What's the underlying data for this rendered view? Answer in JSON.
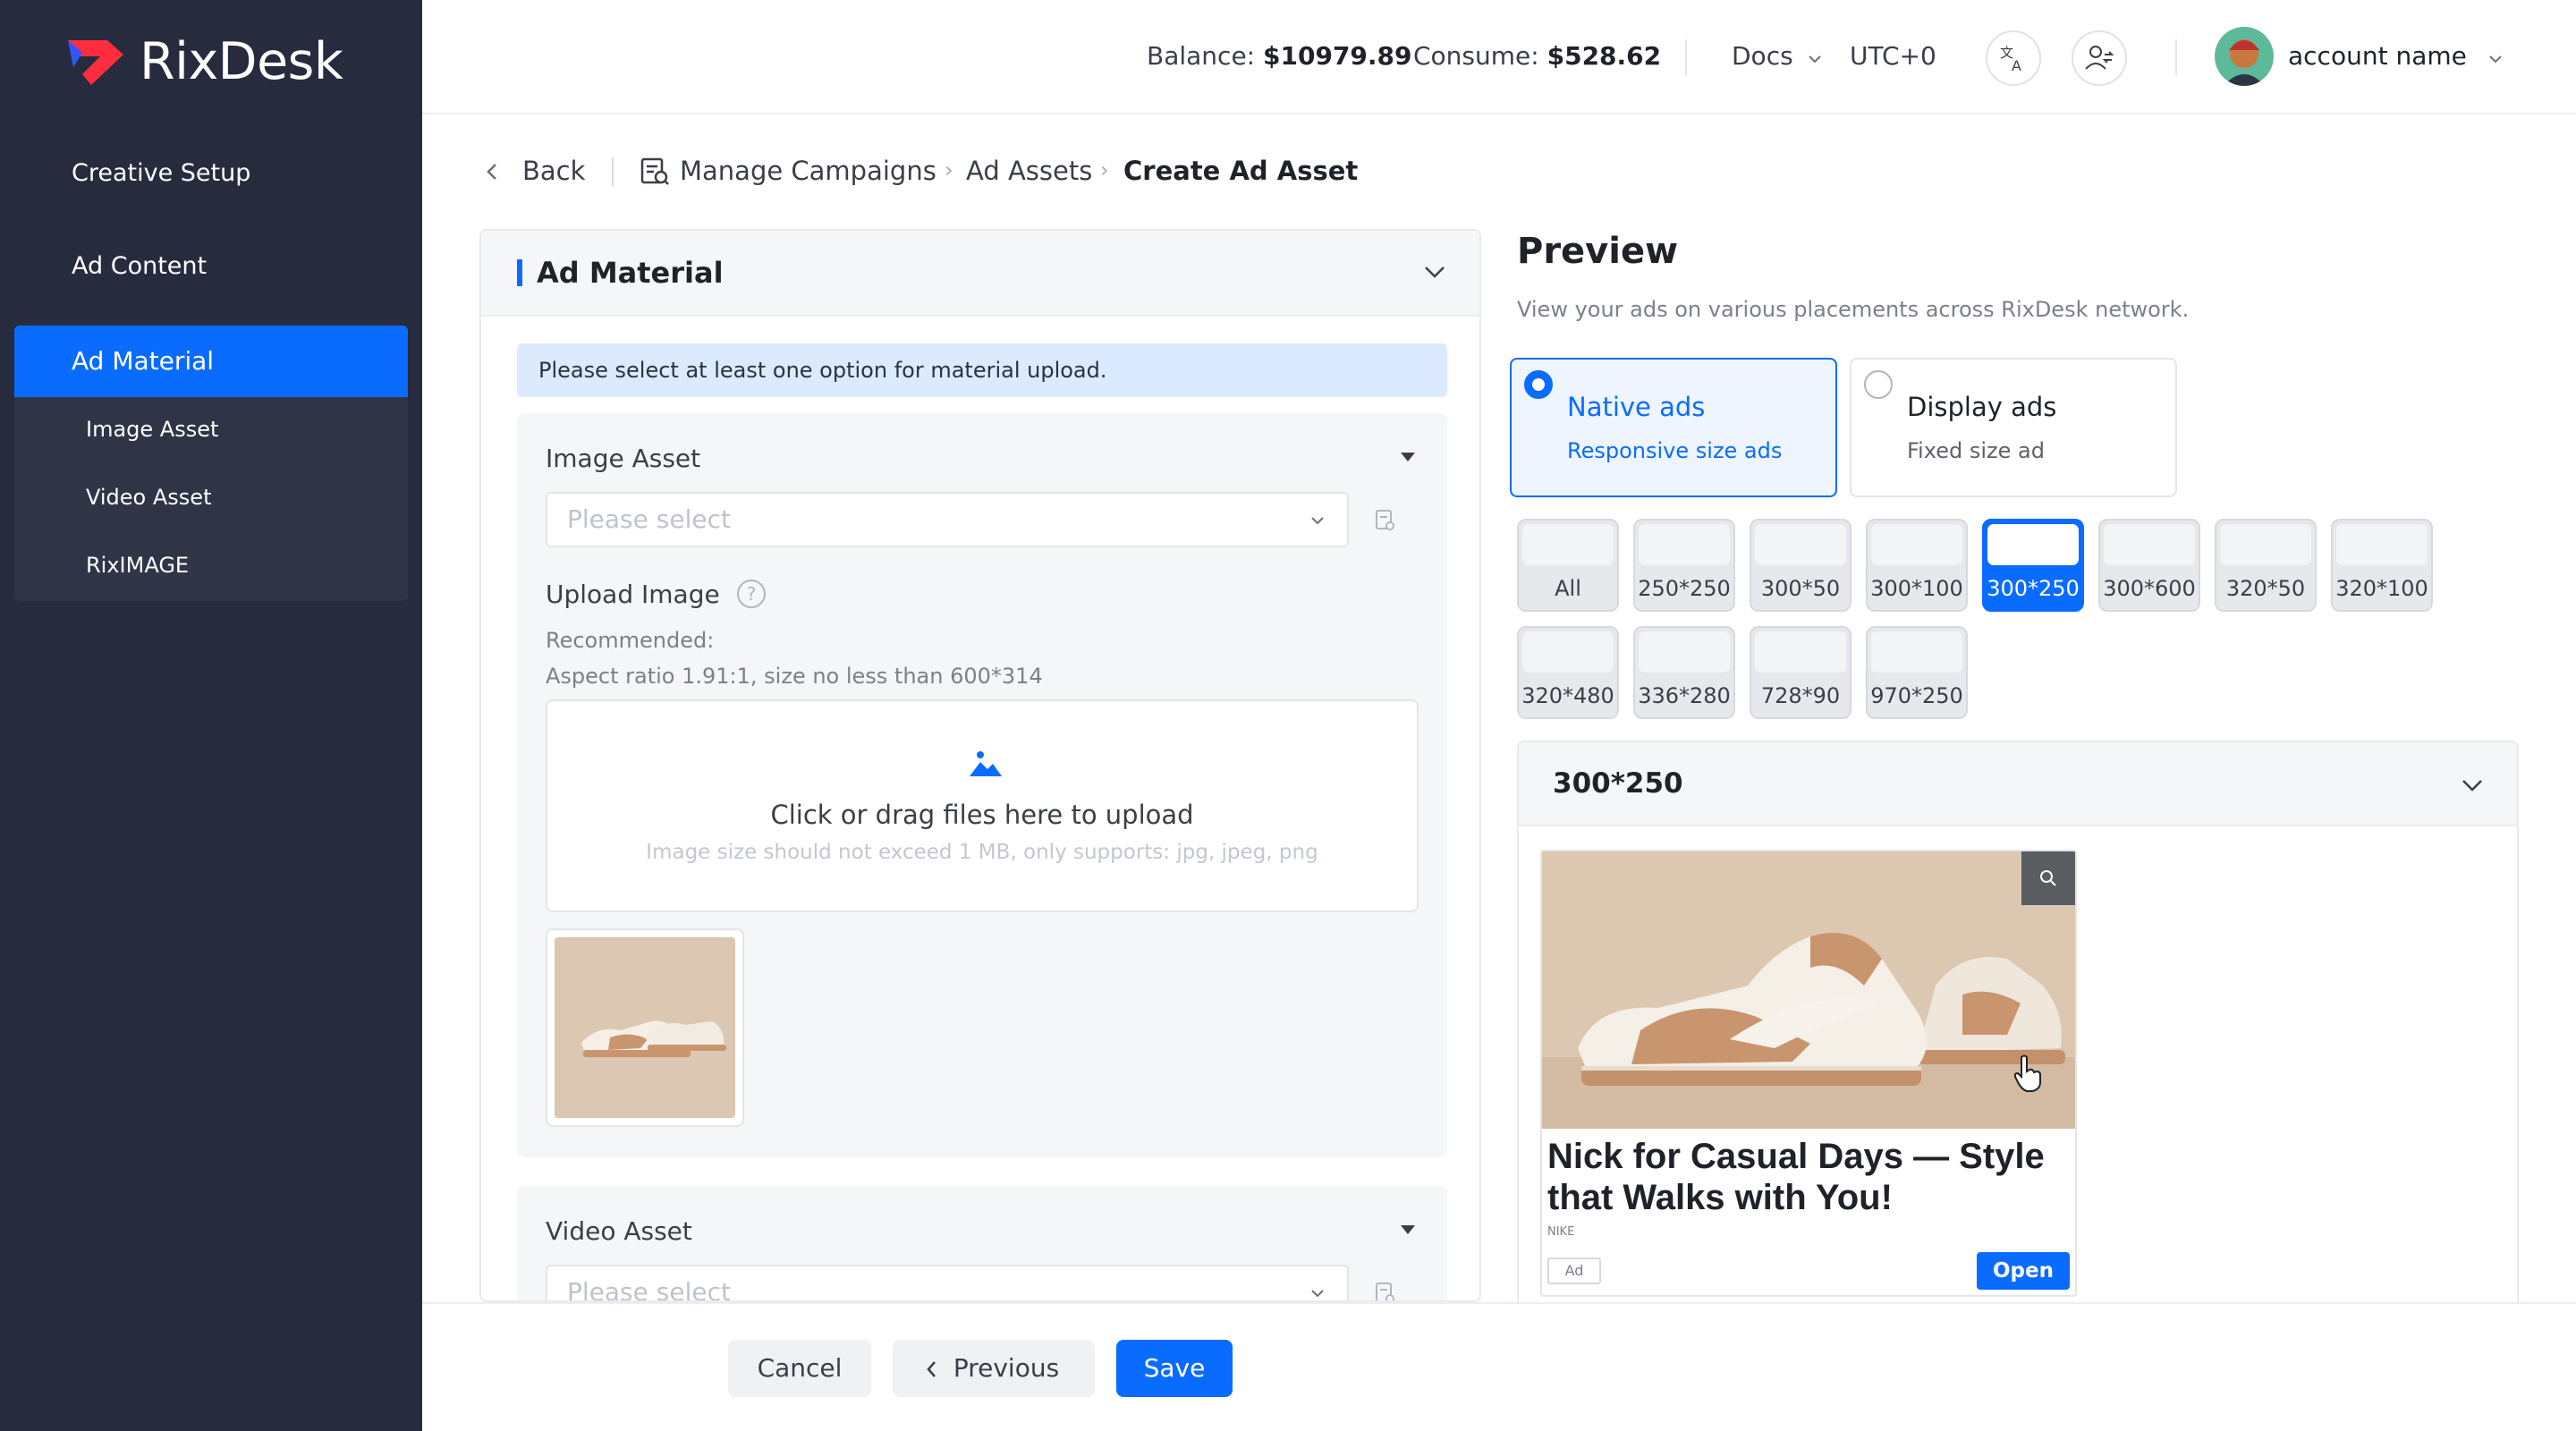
{
  "app": {
    "name": "RixDesk"
  },
  "sidebar": {
    "items": [
      {
        "label": "Creative Setup"
      },
      {
        "label": "Ad Content"
      },
      {
        "label": "Ad Material"
      }
    ],
    "subitems": [
      {
        "label": "Image Asset"
      },
      {
        "label": "Video Asset"
      },
      {
        "label": "RixIMAGE"
      }
    ]
  },
  "header": {
    "balance_label": "Balance:",
    "balance_value": "$10979.89",
    "consume_label": "Consume:",
    "consume_value": "$528.62",
    "docs": "Docs",
    "timezone": "UTC+0",
    "account_name": "account name"
  },
  "breadcrumb": {
    "back": "Back",
    "items": [
      "Manage Campaigns",
      "Ad Assets",
      "Create Ad Asset"
    ]
  },
  "material": {
    "title": "Ad Material",
    "notice": "Please select at least one option for material upload.",
    "image_asset": {
      "title": "Image Asset",
      "placeholder": "Please select",
      "upload_label": "Upload Image",
      "recommended": "Recommended:",
      "aspect": "Aspect ratio 1.91:1, size no less than 600*314",
      "upload_main": "Click or drag files here to upload",
      "upload_hint": "Image size should not exceed 1 MB, only supports: jpg, jpeg, png"
    },
    "video_asset": {
      "title": "Video Asset",
      "placeholder": "Please select"
    }
  },
  "preview": {
    "title": "Preview",
    "subtitle": "View your ads on various placements across RixDesk network.",
    "options": [
      {
        "title": "Native ads",
        "sub": "Responsive size ads",
        "selected": true
      },
      {
        "title": "Display ads",
        "sub": "Fixed size ad",
        "selected": false
      }
    ],
    "sizes": [
      "All",
      "250*250",
      "300*50",
      "300*100",
      "300*250",
      "300*600",
      "320*50",
      "320*100",
      "320*480",
      "336*280",
      "728*90",
      "970*250"
    ],
    "selected_size": "300*250",
    "panel_title": "300*250",
    "ad": {
      "headline": "Nick for Casual Days — Style that Walks with You!",
      "brand": "NIKE",
      "ad_badge": "Ad",
      "cta": "Open"
    }
  },
  "footer": {
    "cancel": "Cancel",
    "previous": "Previous",
    "save": "Save"
  },
  "colors": {
    "accent": "#0a6cff",
    "sidebar": "#262c3d"
  }
}
